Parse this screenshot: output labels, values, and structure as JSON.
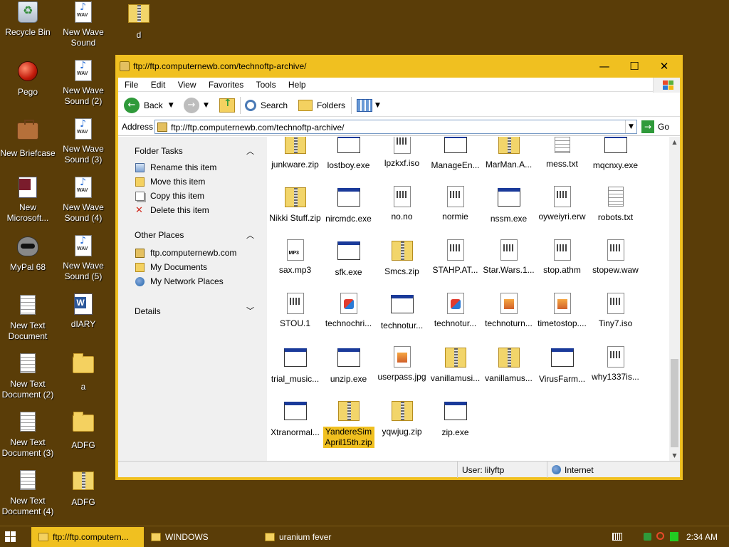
{
  "desktop": {
    "icons": [
      {
        "label": "Recycle Bin"
      },
      {
        "label": "Pego"
      },
      {
        "label": "New Briefcase"
      },
      {
        "label": "New Microsoft..."
      },
      {
        "label": "MyPal 68"
      },
      {
        "label": "New Text Document"
      },
      {
        "label": "New Text Document (2)"
      },
      {
        "label": "New Text Document (3)"
      },
      {
        "label": "New Text Document (4)"
      },
      {
        "label": "New Wave Sound"
      },
      {
        "label": "New Wave Sound (2)"
      },
      {
        "label": "New Wave Sound (3)"
      },
      {
        "label": "New Wave Sound (4)"
      },
      {
        "label": "New Wave Sound (5)"
      },
      {
        "label": "dIARY"
      },
      {
        "label": "a"
      },
      {
        "label": "ADFG"
      },
      {
        "label": "ADFG"
      },
      {
        "label": "d"
      }
    ]
  },
  "window": {
    "title": "ftp://ftp.computernewb.com/technoftp-archive/",
    "controls": {
      "minimize": "—",
      "maximize": "☐",
      "close": "✕"
    },
    "menu": [
      "File",
      "Edit",
      "View",
      "Favorites",
      "Tools",
      "Help"
    ],
    "toolbar": {
      "back": "Back",
      "search": "Search",
      "folders": "Folders"
    },
    "address": {
      "label": "Address",
      "value": "ftp://ftp.computernewb.com/technoftp-archive/",
      "go": "Go"
    },
    "folder_tasks": {
      "title": "Folder Tasks",
      "items": [
        "Rename this item",
        "Move this item",
        "Copy this item",
        "Delete this item"
      ]
    },
    "other_places": {
      "title": "Other Places",
      "items": [
        "ftp.computernewb.com",
        "My Documents",
        "My Network Places"
      ]
    },
    "details": {
      "title": "Details"
    },
    "files": [
      {
        "name": "junkware.zip",
        "type": "zip"
      },
      {
        "name": "lostboy.exe",
        "type": "exe"
      },
      {
        "name": "lpzkxf.iso",
        "type": "doc"
      },
      {
        "name": "ManageEn...",
        "type": "exe"
      },
      {
        "name": "MarMan.A...",
        "type": "zip"
      },
      {
        "name": "mess.txt",
        "type": "txt"
      },
      {
        "name": "mqcnxy.exe",
        "type": "exe"
      },
      {
        "name": "Nikki Stuff.zip",
        "type": "zip"
      },
      {
        "name": "nircmdc.exe",
        "type": "exe"
      },
      {
        "name": "no.no",
        "type": "doc"
      },
      {
        "name": "normie",
        "type": "doc"
      },
      {
        "name": "nssm.exe",
        "type": "exe"
      },
      {
        "name": "oyweiyri.erw",
        "type": "doc"
      },
      {
        "name": "robots.txt",
        "type": "txt"
      },
      {
        "name": "sax.mp3",
        "type": "mp3"
      },
      {
        "name": "sfk.exe",
        "type": "exe"
      },
      {
        "name": "Smcs.zip",
        "type": "zip"
      },
      {
        "name": "STAHP.AT...",
        "type": "doc"
      },
      {
        "name": "Star.Wars.1...",
        "type": "doc"
      },
      {
        "name": "stop.athm",
        "type": "doc"
      },
      {
        "name": "stopew.waw",
        "type": "doc"
      },
      {
        "name": "STOU.1",
        "type": "doc"
      },
      {
        "name": "technochri...",
        "type": "app"
      },
      {
        "name": "technotur...",
        "type": "exe"
      },
      {
        "name": "technotur...",
        "type": "app"
      },
      {
        "name": "technoturn...",
        "type": "img"
      },
      {
        "name": "timetostop....",
        "type": "img"
      },
      {
        "name": "Tiny7.iso",
        "type": "doc"
      },
      {
        "name": "trial_music...",
        "type": "exe"
      },
      {
        "name": "unzip.exe",
        "type": "exe"
      },
      {
        "name": "userpass.jpg",
        "type": "img"
      },
      {
        "name": "vanillamusi...",
        "type": "zip"
      },
      {
        "name": "vanillamus...",
        "type": "zip"
      },
      {
        "name": "VirusFarm...",
        "type": "exe"
      },
      {
        "name": "why1337is...",
        "type": "doc"
      },
      {
        "name": "Xtranormal...",
        "type": "exe"
      },
      {
        "name": "YandereSimApril15th.zip",
        "type": "zip",
        "selected": true
      },
      {
        "name": "yqwjug.zip",
        "type": "zip"
      },
      {
        "name": "zip.exe",
        "type": "exe"
      }
    ],
    "status": {
      "user": "User: lilyftp",
      "zone": "Internet"
    }
  },
  "taskbar": {
    "tasks": [
      {
        "label": "ftp://ftp.computern...",
        "active": true
      },
      {
        "label": "WINDOWS",
        "active": false
      },
      {
        "label": "uranium fever",
        "active": false
      }
    ],
    "clock": "2:34 AM"
  },
  "colors": {
    "accent": "#f0c020",
    "desktop": "#5a3d08"
  }
}
